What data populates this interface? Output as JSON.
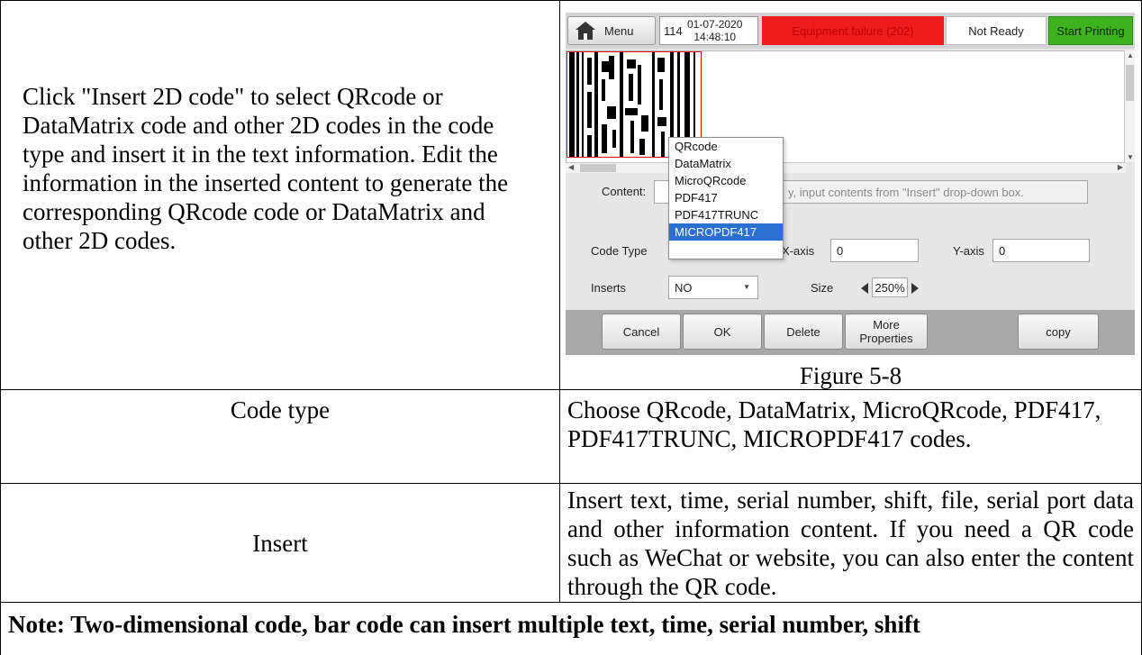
{
  "description": "Click \"Insert 2D code\" to select QRcode or DataMatrix code and other 2D codes in the code type and insert it in the text information. Edit the information in the inserted content to generate the corresponding QRcode code or DataMatrix and other 2D codes.",
  "figure_caption": "Figure 5-8",
  "rows": [
    {
      "label": "Code type",
      "value": "Choose QRcode, DataMatrix, MicroQRcode, PDF417, PDF417TRUNC, MICROPDF417 codes."
    },
    {
      "label": "Insert",
      "value": "Insert text, time, serial number, shift, file, serial port data and other information content. If you need a QR code such as WeChat or website, you can also enter the content through the QR code."
    }
  ],
  "note": "Note: Two-dimensional code, bar code can insert multiple text, time, serial number, shift",
  "screenshot": {
    "menu_label": "Menu",
    "counter": "114",
    "date": "01-07-2020",
    "time": "14:48:10",
    "alarm": "Equipment failure (202)",
    "status": "Not Ready",
    "start_label": "Start Printing",
    "content_label": "Content:",
    "content_placeholder": "y, input contents from \"Insert\" drop-down box.",
    "code_type_label": "Code Type",
    "x_axis_label": "X-axis",
    "x_axis_value": "0",
    "y_axis_label": "Y-axis",
    "y_axis_value": "0",
    "inserts_label": "Inserts",
    "inserts_value": "NO",
    "size_label": "Size",
    "size_value": "250%",
    "code_type_options": [
      "QRcode",
      "DataMatrix",
      "MicroQRcode",
      "PDF417",
      "PDF417TRUNC",
      "MICROPDF417"
    ],
    "selected_option": "MICROPDF417",
    "buttons": {
      "cancel": "Cancel",
      "ok": "OK",
      "delete": "Delete",
      "more": "More Properties",
      "copy": "copy"
    },
    "colors": {
      "alarm_bg": "#ee1c1c",
      "start_bg": "#3fb21f",
      "selection": "#2b6fd0"
    }
  }
}
